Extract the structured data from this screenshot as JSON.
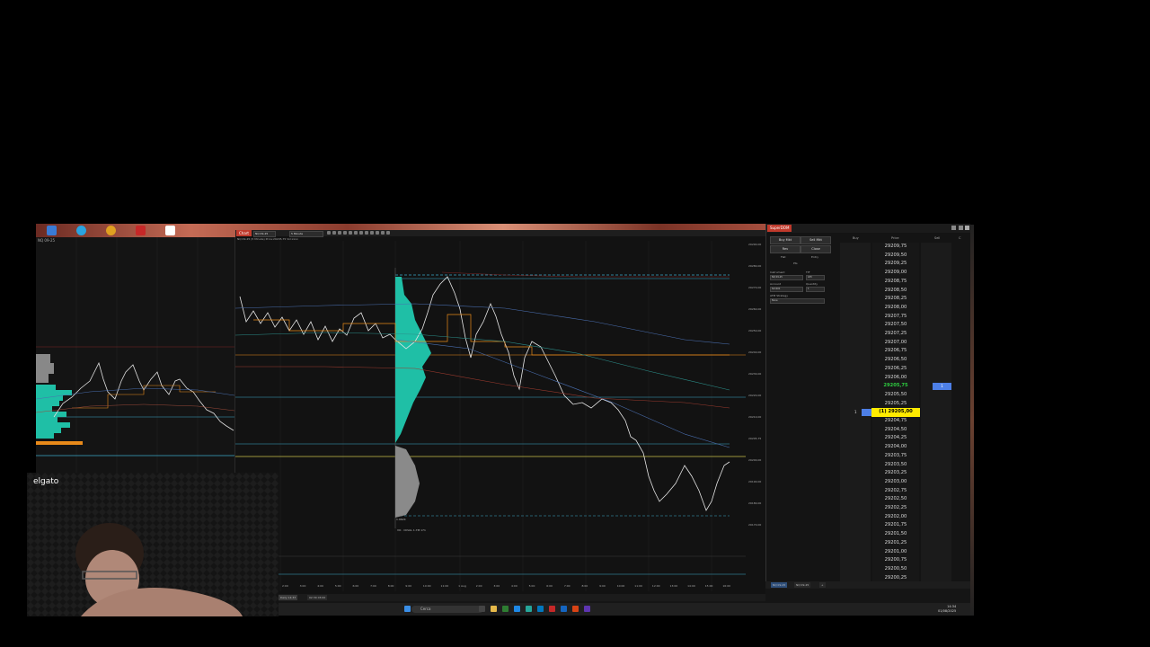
{
  "overlay": {
    "webcam_label": "elgato"
  },
  "left_chart": {
    "title": "NQ 09-25"
  },
  "main_chart": {
    "tab_label": "Chart",
    "instrument": "NQ 09-25",
    "period": "5 Minute",
    "info_line": "NQ 09-25 (5 Minute) Price:29205,75 Vol:xxxx",
    "price_ticks": [
      "29290,00",
      "29280,00",
      "29270,00",
      "29260,00",
      "29250,00",
      "29240,00",
      "29230,00",
      "29220,00",
      "29210,00",
      "29205,75",
      "29200,00",
      "29190,00",
      "29180,00",
      "29170,00"
    ],
    "time_ticks": [
      "2:00",
      "3:00",
      "4:00",
      "5:00",
      "6:00",
      "7:00",
      "8:00",
      "9:00",
      "10:00",
      "11:00",
      "1 Aug",
      "2:00",
      "3:00",
      "4:00",
      "5:00",
      "6:00",
      "7:00",
      "8:00",
      "9:00",
      "10:00",
      "11:00",
      "12:00",
      "13:00",
      "14:00",
      "15:00",
      "16:00"
    ],
    "bottom_tabs": [
      "Daily 14:33",
      "02:30 03:00"
    ],
    "volume_label": "1.962K",
    "indicator_label": "VO · CKVAL 1.7M 171"
  },
  "superdom": {
    "title": "SuperDOM",
    "buy_mkt": "Buy Mkt",
    "sell_mkt": "Sell Mkt",
    "rev": "Rev",
    "close": "Close",
    "flat": "Flat",
    "entry": "Entry",
    "pnl": "Pts",
    "instrument_label": "Instrument",
    "instrument_value": "NQ 09-25",
    "tif_label": "TIF",
    "tif_value": "GTC",
    "account_label": "Account",
    "account_value": "Sim101",
    "quantity_label": "Quantity",
    "quantity_value": "1",
    "atm_label": "ATM Strategy",
    "atm_value": "None",
    "headers": {
      "buy": "Buy",
      "price": "Price",
      "sell": "Sell",
      "c": "C"
    },
    "ladder": [
      {
        "price": "29209,75"
      },
      {
        "price": "29209,50"
      },
      {
        "price": "29209,25"
      },
      {
        "price": "29209,00"
      },
      {
        "price": "29208,75"
      },
      {
        "price": "29208,50"
      },
      {
        "price": "29208,25"
      },
      {
        "price": "29208,00"
      },
      {
        "price": "29207,75"
      },
      {
        "price": "29207,50"
      },
      {
        "price": "29207,25"
      },
      {
        "price": "29207,00"
      },
      {
        "price": "29206,75"
      },
      {
        "price": "29206,50"
      },
      {
        "price": "29206,25"
      },
      {
        "price": "29206,00"
      },
      {
        "price": "29205,75",
        "state": "last",
        "sell": "1"
      },
      {
        "price": "29205,50"
      },
      {
        "price": "29205,25"
      },
      {
        "price": "(1) 29205,00",
        "state": "pos",
        "qty": "1"
      },
      {
        "price": "29204,75"
      },
      {
        "price": "29204,50"
      },
      {
        "price": "29204,25"
      },
      {
        "price": "29204,00"
      },
      {
        "price": "29203,75"
      },
      {
        "price": "29203,50"
      },
      {
        "price": "29203,25"
      },
      {
        "price": "29203,00"
      },
      {
        "price": "29202,75"
      },
      {
        "price": "29202,50"
      },
      {
        "price": "29202,25"
      },
      {
        "price": "29202,00"
      },
      {
        "price": "29201,75"
      },
      {
        "price": "29201,50"
      },
      {
        "price": "29201,25"
      },
      {
        "price": "29201,00"
      },
      {
        "price": "29200,75"
      },
      {
        "price": "29200,50"
      },
      {
        "price": "29200,25"
      },
      {
        "price": "29200,00"
      }
    ],
    "bottom_tabs": [
      "NQ 09-25",
      "NQ 09-25"
    ]
  },
  "taskbar": {
    "search_placeholder": "Cerca",
    "time": "14:34",
    "date": "01/08/2025"
  },
  "colors": {
    "accent": "#c0392b",
    "profile": "#1fbfa6",
    "last_price": "#2ecc40",
    "position": "#ffeb00",
    "order": "#4d7fe6"
  }
}
